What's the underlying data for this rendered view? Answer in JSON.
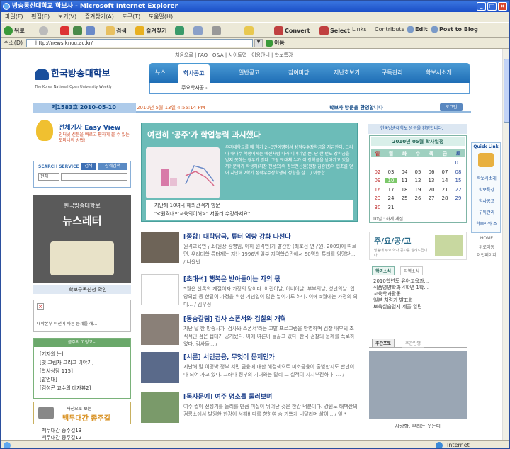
{
  "window": {
    "title": "방송통신대학교 학보사 - Microsoft Internet Explorer"
  },
  "menu": [
    "파일(F)",
    "편집(E)",
    "보기(V)",
    "즐겨찾기(A)",
    "도구(T)",
    "도움말(H)"
  ],
  "toolbar": {
    "back": "뒤로",
    "search": "검색",
    "favorites": "즐겨찾기",
    "convert": "Convert",
    "select": "Select",
    "links": "Links",
    "contribute": "Contribute",
    "edit": "Edit",
    "post": "Post to Blog"
  },
  "address": {
    "label": "주소(D)",
    "url": "http://news.knou.ac.kr/",
    "go": "이동"
  },
  "site": {
    "topnav": "처음으로 | FAQ | Q&A | 사이트맵 | 이용안내 | 학보특강",
    "logo": "한국방송대학보",
    "logo_sub": "The Korea National Open University Weekly",
    "nav": [
      "뉴스",
      "학사공고",
      "일반공고",
      "참여마당",
      "지난호보기",
      "구독관리",
      "학보사소개"
    ],
    "subnav": "주요학사공고",
    "issue": "제1583호 2010-05-10",
    "today": "2010년 5월 13일   4:55:14 PM",
    "welcome": "학보사 방문을 환영합니다",
    "login": "로그인"
  },
  "left": {
    "easyview_title": "전체기사 Easy View",
    "easyview_desc": "인터넷 신문을 빠르고 편하게 볼 수 있는 토마니의 방법!",
    "search_label": "SEARCH SERVICE",
    "search_btn": "검색",
    "detail_btn": "상세검색",
    "search_select": "전체",
    "newsletter_small": "한국방송대학보",
    "newsletter_big": "뉴스레터",
    "subscribe": "학보구독신청 확인",
    "notice": "대학본부 이전에 따른 문제를 해...",
    "column_title": "금주의 고정코너",
    "columns": [
      "[기자의 눈]",
      "[빛 그림자 그리고 이야기]",
      "[학사상담 115]",
      "[발언대]",
      "[김성곤 교수의 데자뷰2]"
    ],
    "photo_label": "사진으로 보는",
    "photo_big": "백두대간 종주길",
    "photo_items": [
      "백두대간 종주길13",
      "백두대간 종주길12"
    ]
  },
  "center": {
    "feature_title": "여전히 '공주'가 학업능력 과시했다",
    "feature_text": "우리대학교를 매 학기 2~3만여명에서 성적우수장학금을 지급한다. 그러나 대다수 학생에게는 예전처럼 나라 이야기일 뿐, 단 한 번도 장학금을 받지 못하는 경우가 많다. 그럼 도대체 누가 이 장학금을 받아가고 있을까? 분석가 학생처(처장 전용오)와 정보전산원(원장 김갑현)의 협조를 얻어 지난해 2학기 성적우수장학생의 성향을 살... / 이승한",
    "feature_sub1": "지난해 10여국 해외관객가 방문",
    "feature_sub2": "\"<원격대학교육의이해>\" 서울러 수강하세요\"",
    "articles": [
      {
        "title": "[종합] 대학당국, 튜터 역량 강화 나선다",
        "body": "원격교육연구소(원장 김영임, 이하 원격연)가 발간한 (최호선 연구원, 2009)에 따르면, 우리대학 튜터제는 지난 1996년 일부 지역학습관에서 50명의 튜터를 임명받... / 나윤빈"
      },
      {
        "title": "[초대석] 행복은 받아들이는 자의 몫",
        "body": "5월은 신록의 계절이자 가정의 달이다. 어린이날, 어버이날, 부부의날, 성년의날. 입양의날 등 한달이 가정을 위한 기념일이 많은 날이기도 하다. 이에 5월에는 가정의 의미... / 김우정"
      },
      {
        "title": "[동송칼럼] 검사 스폰서와 검찰의 개혁",
        "body": "지난 달 한 방송사가 '검사와 스폰서'라는 고발 프로그램을 방영하며 검찰 내부의 조직적인 검은 접대가 공개됐다. 이에 여론이 들끓고 있다. 한국 검찰의 문제를 폭로하였다. 검사들... /"
      },
      {
        "title": "[시론] 서민금융, 무엇이 문제인가",
        "body": "지난해 말 이명박 정부 서민 금융에 대한 해결책으로 미소금융이 출범한지도 반년이 다 되어 가고 있다. 그러나 정부의 기대와는 달리 그 실적이 지지부진하다. ... /"
      },
      {
        "title": "[독자문예] 여주 명소를 둘러보며",
        "body": "여주 쌀이 전성기를 돌리를 만큼 미질이 뛰어난 것은 한강 덕분이다. 강원도 태백산의 검룡소에서 발원한 한강이 서해바다를 향하여 숨 가쁘게 내달리며 삶이... / 일 *"
      }
    ]
  },
  "right": {
    "welcome": "한국방송대학보 방문을 환영합니다.",
    "cal_title": "2010년 05월 학사일정",
    "weekdays": [
      "일",
      "월",
      "화",
      "수",
      "목",
      "금",
      "토"
    ],
    "days": [
      "",
      "",
      "",
      "",
      "",
      "",
      "01",
      "02",
      "03",
      "04",
      "05",
      "06",
      "07",
      "08",
      "09",
      "10",
      "11",
      "12",
      "13",
      "14",
      "15",
      "16",
      "17",
      "18",
      "19",
      "20",
      "21",
      "22",
      "23",
      "24",
      "25",
      "26",
      "27",
      "28",
      "29",
      "30",
      "31",
      "",
      "",
      "",
      "",
      ""
    ],
    "cal_note": "10일 : 하계 계절..",
    "ad_title": "주/요/공/고",
    "ad_sub": "방송대 주요 학사 공고를 알려드립니다.",
    "tabs": [
      "학과소식",
      "지역소식"
    ],
    "news": [
      "2010학년도 유아교육과...",
      "식품영양학과 4학년 1학...",
      "교육학과활동",
      "일본 처럼가 발표회",
      "보육실습일지 제출 알림"
    ],
    "photo_tabs": [
      "주간포토",
      "주간만평"
    ],
    "photo_caption": "사랑할, 우리는 웃는다",
    "quick": {
      "title": "Quick Link",
      "items": [
        "학보사소개",
        "학보특강",
        "학사공고",
        "구독관리",
        "학보사와 소",
        "HOME",
        "위로이동",
        "이전페이지"
      ]
    }
  },
  "status": {
    "zone": "Internet"
  }
}
